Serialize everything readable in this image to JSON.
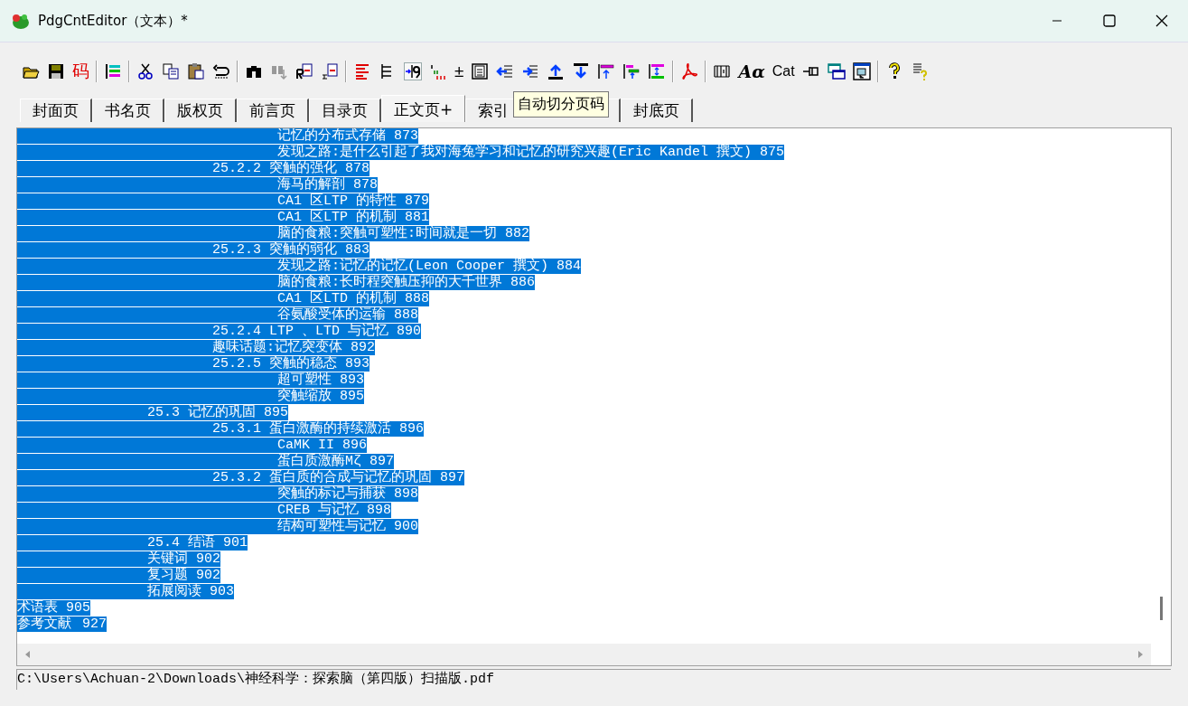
{
  "window": {
    "title": "PdgCntEditor（文本）*"
  },
  "toolbar": [
    [
      {
        "kind": "icon"
      },
      {
        "kind": "icon"
      },
      {
        "kind": "text",
        "text": "码",
        "color": "#e00000"
      }
    ],
    [
      {
        "kind": "icon"
      }
    ],
    [
      {
        "kind": "icon"
      },
      {
        "kind": "icon"
      },
      {
        "kind": "icon"
      },
      {
        "kind": "icon"
      }
    ],
    [
      {
        "kind": "icon"
      },
      {
        "kind": "icon"
      },
      {
        "kind": "icon"
      },
      {
        "kind": "icon"
      }
    ],
    [
      {
        "kind": "icon"
      },
      {
        "kind": "icon"
      },
      {
        "kind": "icon"
      },
      {
        "kind": "icon"
      },
      {
        "kind": "text",
        "text": "±",
        "color": "#000000"
      },
      {
        "kind": "icon"
      },
      {
        "kind": "icon"
      },
      {
        "kind": "icon"
      },
      {
        "kind": "icon"
      },
      {
        "kind": "icon"
      },
      {
        "kind": "icon"
      },
      {
        "kind": "icon"
      },
      {
        "kind": "icon"
      }
    ],
    [
      {
        "kind": "icon"
      }
    ],
    [
      {
        "kind": "icon"
      },
      {
        "kind": "text",
        "text": "Aα",
        "color": "#000000"
      },
      {
        "kind": "text",
        "text": "Cat",
        "color": "#000000"
      },
      {
        "kind": "icon"
      },
      {
        "kind": "icon"
      },
      {
        "kind": "icon"
      }
    ],
    [
      {
        "kind": "icon"
      },
      {
        "kind": "icon"
      }
    ]
  ],
  "tooltip": "自动切分页码",
  "tabs": [
    {
      "label": "封面页",
      "selected": false
    },
    {
      "label": "书名页",
      "selected": false
    },
    {
      "label": "版权页",
      "selected": false
    },
    {
      "label": "前言页",
      "selected": false
    },
    {
      "label": "目录页",
      "selected": false
    },
    {
      "label": "正文页+",
      "selected": true
    },
    {
      "label": "索引",
      "selected": false
    },
    {
      "label": "封底页",
      "selected": false
    }
  ],
  "lines": [
    {
      "text": "\t\t\t\t记忆的分布式存储 873",
      "selected": true
    },
    {
      "text": "\t\t\t\t发现之路:是什么引起了我对海兔学习和记忆的研究兴趣(Eric Kandel 撰文) 875",
      "selected": true
    },
    {
      "text": "\t\t\t25.2.2 突触的强化 878",
      "selected": true
    },
    {
      "text": "\t\t\t\t海马的解剖 878",
      "selected": true
    },
    {
      "text": "\t\t\t\tCA1 区LTP 的特性 879",
      "selected": true
    },
    {
      "text": "\t\t\t\tCA1 区LTP 的机制 881",
      "selected": true
    },
    {
      "text": "\t\t\t\t脑的食粮:突触可塑性:时间就是一切 882",
      "selected": true
    },
    {
      "text": "\t\t\t25.2.3 突触的弱化 883",
      "selected": true
    },
    {
      "text": "\t\t\t\t发现之路:记忆的记忆(Leon Cooper 撰文) 884",
      "selected": true
    },
    {
      "text": "\t\t\t\t脑的食粮:长时程突触压抑的大千世界 886",
      "selected": true
    },
    {
      "text": "\t\t\t\tCA1 区LTD 的机制 888",
      "selected": true
    },
    {
      "text": "\t\t\t\t谷氨酸受体的运输 888",
      "selected": true
    },
    {
      "text": "\t\t\t25.2.4 LTP 、LTD 与记忆 890",
      "selected": true
    },
    {
      "text": "\t\t\t趣味话题:记忆突变体 892",
      "selected": true
    },
    {
      "text": "\t\t\t25.2.5 突触的稳态 893",
      "selected": true
    },
    {
      "text": "\t\t\t\t超可塑性 893",
      "selected": true
    },
    {
      "text": "\t\t\t\t突触缩放 895",
      "selected": true
    },
    {
      "text": "\t\t25.3 记忆的巩固 895",
      "selected": true
    },
    {
      "text": "\t\t\t25.3.1 蛋白激酶的持续激活 896",
      "selected": true
    },
    {
      "text": "\t\t\t\tCaMK II 896",
      "selected": true
    },
    {
      "text": "\t\t\t\t蛋白质激酶Mζ 897",
      "selected": true
    },
    {
      "text": "\t\t\t25.3.2 蛋白质的合成与记忆的巩固 897",
      "selected": true
    },
    {
      "text": "\t\t\t\t突触的标记与捕获 898",
      "selected": true
    },
    {
      "text": "\t\t\t\tCREB 与记忆 898",
      "selected": true
    },
    {
      "text": "\t\t\t\t结构可塑性与记忆 900",
      "selected": true
    },
    {
      "text": "\t\t25.4 结语 901",
      "selected": true
    },
    {
      "text": "\t\t关键词 902",
      "selected": true
    },
    {
      "text": "\t\t复习题 902",
      "selected": true
    },
    {
      "text": "\t\t拓展阅读 903",
      "selected": true
    },
    {
      "text": "术语表 905",
      "selected": true
    },
    {
      "text": "参考文献\t927",
      "selected": true
    }
  ],
  "status_bar": "C:\\Users\\Achuan-2\\Downloads\\神经科学：探索脑（第四版）扫描版.pdf"
}
